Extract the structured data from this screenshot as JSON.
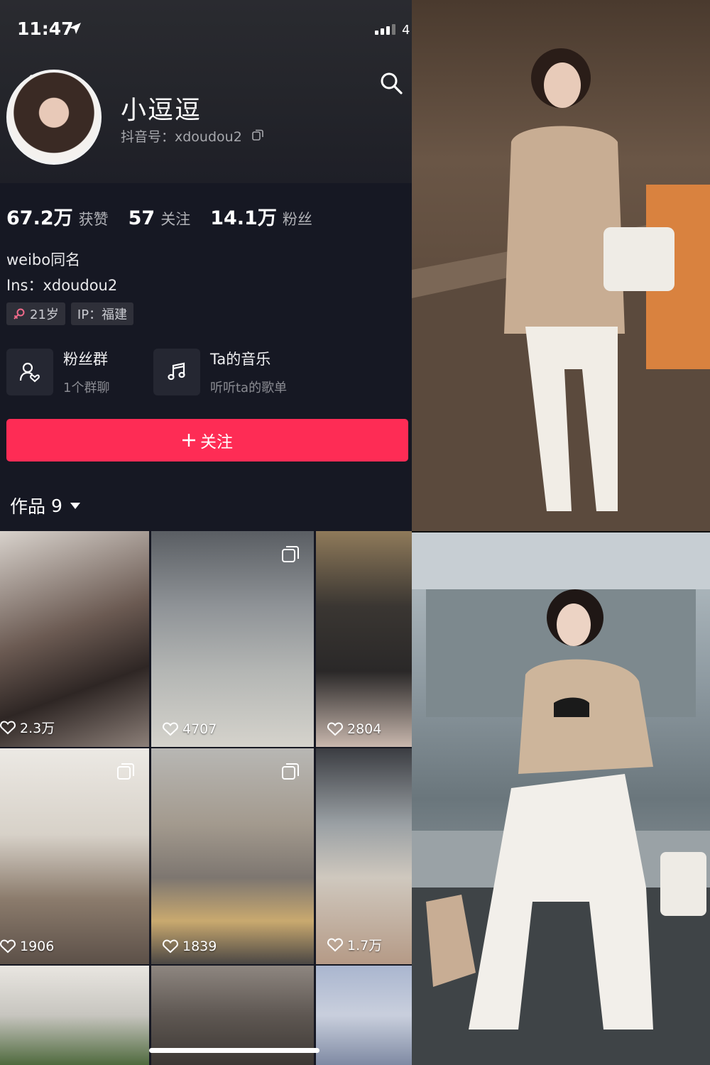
{
  "status_bar": {
    "time": "11:47",
    "battery": "4"
  },
  "profile": {
    "nickname": "小逗逗",
    "douyin_id": "抖音号：xdoudou2",
    "stats": [
      {
        "num": "67.2万",
        "label": "获赞"
      },
      {
        "num": "57",
        "label": "关注"
      },
      {
        "num": "14.1万",
        "label": "粉丝"
      }
    ],
    "bio": [
      "weibo同名",
      "Ins：xdoudou2"
    ],
    "tags": {
      "age": "21岁",
      "ip": "IP：福建"
    },
    "features": [
      {
        "title": "粉丝群",
        "sub": "1个群聊",
        "icon": "fan-group-icon"
      },
      {
        "title": "Ta的音乐",
        "sub": "听听ta的歌单",
        "icon": "music-note-icon"
      }
    ],
    "follow_label": "关注",
    "works_label": "作品",
    "works_count": "9"
  },
  "videos": [
    {
      "likes": "2.3万",
      "multi": false
    },
    {
      "likes": "4707",
      "multi": true
    },
    {
      "likes": "2804",
      "multi": false
    },
    {
      "likes": "1906",
      "multi": true
    },
    {
      "likes": "1839",
      "multi": true
    },
    {
      "likes": "1.7万",
      "multi": false
    }
  ],
  "colors": {
    "background": "#161823",
    "follow": "#fe2c55",
    "muted": "#a7a8ad"
  }
}
